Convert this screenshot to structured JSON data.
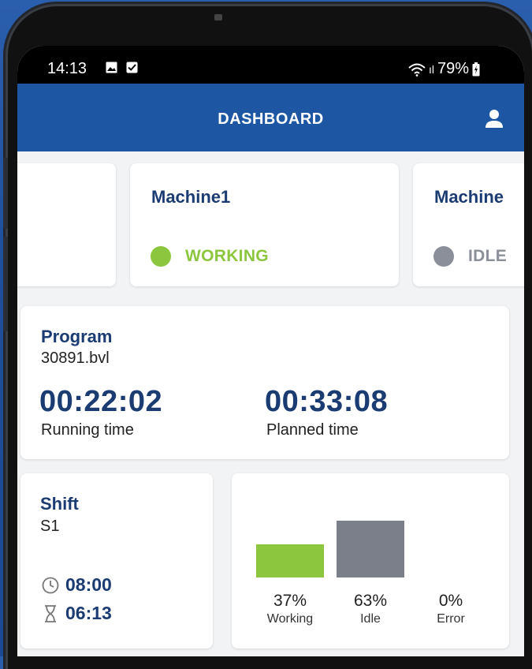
{
  "status_bar": {
    "time": "14:13",
    "signal": "ıl",
    "battery": "79%"
  },
  "app_bar": {
    "title": "DASHBOARD",
    "user_icon": "user-icon"
  },
  "machines": [
    {
      "name": "",
      "status": ""
    },
    {
      "name": "Machine1",
      "status": "WORKING",
      "status_color": "#8cc63f"
    },
    {
      "name": "Machine",
      "status": "IDLE",
      "status_color": "#8a8f99"
    }
  ],
  "program": {
    "label": "Program",
    "file": "30891.bvl",
    "running_time": "00:22:02",
    "running_label": "Running time",
    "planned_time": "00:33:08",
    "planned_label": "Planned time"
  },
  "shift": {
    "label": "Shift",
    "name": "S1",
    "start_time": "08:00",
    "elapsed_time": "06:13",
    "icons": [
      "clock-icon",
      "hourglass-icon"
    ]
  },
  "chart_data": {
    "type": "bar",
    "categories": [
      "Working",
      "Idle",
      "Error"
    ],
    "values": [
      37,
      63,
      0
    ],
    "labels": [
      "37%",
      "63%",
      "0%"
    ],
    "colors": [
      "#8cc63f",
      "#7a7f8a",
      "#c0392b"
    ],
    "ylim": [
      0,
      63
    ]
  },
  "colors": {
    "primary": "#1d57a4",
    "text_blue": "#1b3b73",
    "working": "#8cc63f",
    "idle": "#8a8f99"
  }
}
